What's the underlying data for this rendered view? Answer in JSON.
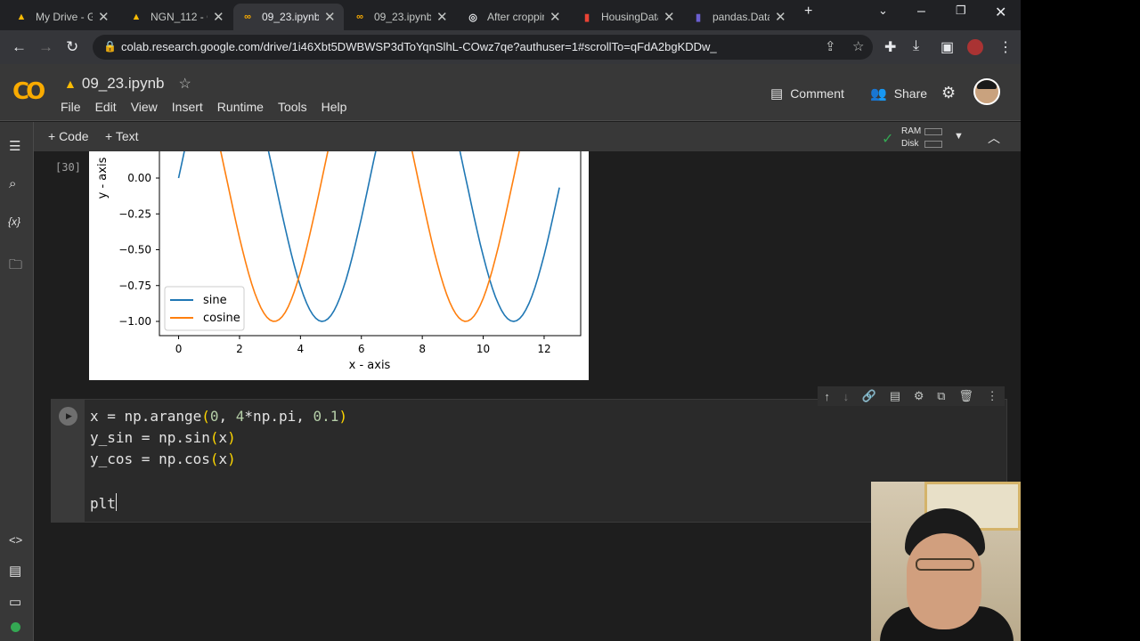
{
  "tabs": [
    {
      "title": "My Drive - G",
      "icon": "drive-icon",
      "active": false
    },
    {
      "title": "NGN_112 - G",
      "icon": "drive-icon",
      "active": false
    },
    {
      "title": "09_23.ipynb",
      "icon": "colab-icon",
      "active": true
    },
    {
      "title": "09_23.ipynb",
      "icon": "colab-icon",
      "active": false
    },
    {
      "title": "After croppin",
      "icon": "github-icon",
      "active": false
    },
    {
      "title": "HousingData",
      "icon": "chart-icon",
      "active": false
    },
    {
      "title": "pandas.Data",
      "icon": "pandas-icon",
      "active": false
    }
  ],
  "address": {
    "url": "colab.research.google.com/drive/1i46Xbt5DWBWSP3dToYqnSlhL-COwz7qe?authuser=1#scrollTo=qFdA2bgKDDw_"
  },
  "header": {
    "logo": "CO",
    "notebook_title": "09_23.ipynb",
    "menus": [
      "File",
      "Edit",
      "View",
      "Insert",
      "Runtime",
      "Tools",
      "Help"
    ],
    "comment_label": "Comment",
    "share_label": "Share"
  },
  "toolbar": {
    "code_label": "+ Code",
    "text_label": "+ Text",
    "ram_label": "RAM",
    "disk_label": "Disk"
  },
  "output": {
    "exec_count": "[30]",
    "chart_data": {
      "type": "line",
      "xlabel": "x - axis",
      "ylabel": "y - axis",
      "xticks": [
        0,
        2,
        4,
        6,
        8,
        10,
        12
      ],
      "yticks": [
        "0.00",
        "−0.25",
        "−0.50",
        "−0.75",
        "−1.00"
      ],
      "ylim_visible": [
        -1.05,
        0.2
      ],
      "xlim": [
        -0.63,
        13.2
      ],
      "x_start": 0,
      "x_end": 12.5,
      "x_step": 0.1,
      "series": [
        {
          "name": "sine",
          "color": "#1f77b4",
          "function": "sin"
        },
        {
          "name": "cosine",
          "color": "#ff7f0e",
          "function": "cos"
        }
      ],
      "legend": "lower-left"
    }
  },
  "code_cell": {
    "lines": [
      [
        {
          "t": "x = np.arange"
        },
        {
          "t": "(",
          "c": "punct"
        },
        {
          "t": "0",
          "c": "num"
        },
        {
          "t": ", "
        },
        {
          "t": "4",
          "c": "num"
        },
        {
          "t": "*np.pi, "
        },
        {
          "t": "0.1",
          "c": "num"
        },
        {
          "t": ")",
          "c": "punct"
        }
      ],
      [
        {
          "t": "y_sin = np.sin"
        },
        {
          "t": "(",
          "c": "punct"
        },
        {
          "t": "x"
        },
        {
          "t": ")",
          "c": "punct"
        }
      ],
      [
        {
          "t": "y_cos = np.cos"
        },
        {
          "t": "(",
          "c": "punct"
        },
        {
          "t": "x"
        },
        {
          "t": ")",
          "c": "punct"
        }
      ],
      [],
      [
        {
          "t": "plt"
        }
      ]
    ]
  }
}
